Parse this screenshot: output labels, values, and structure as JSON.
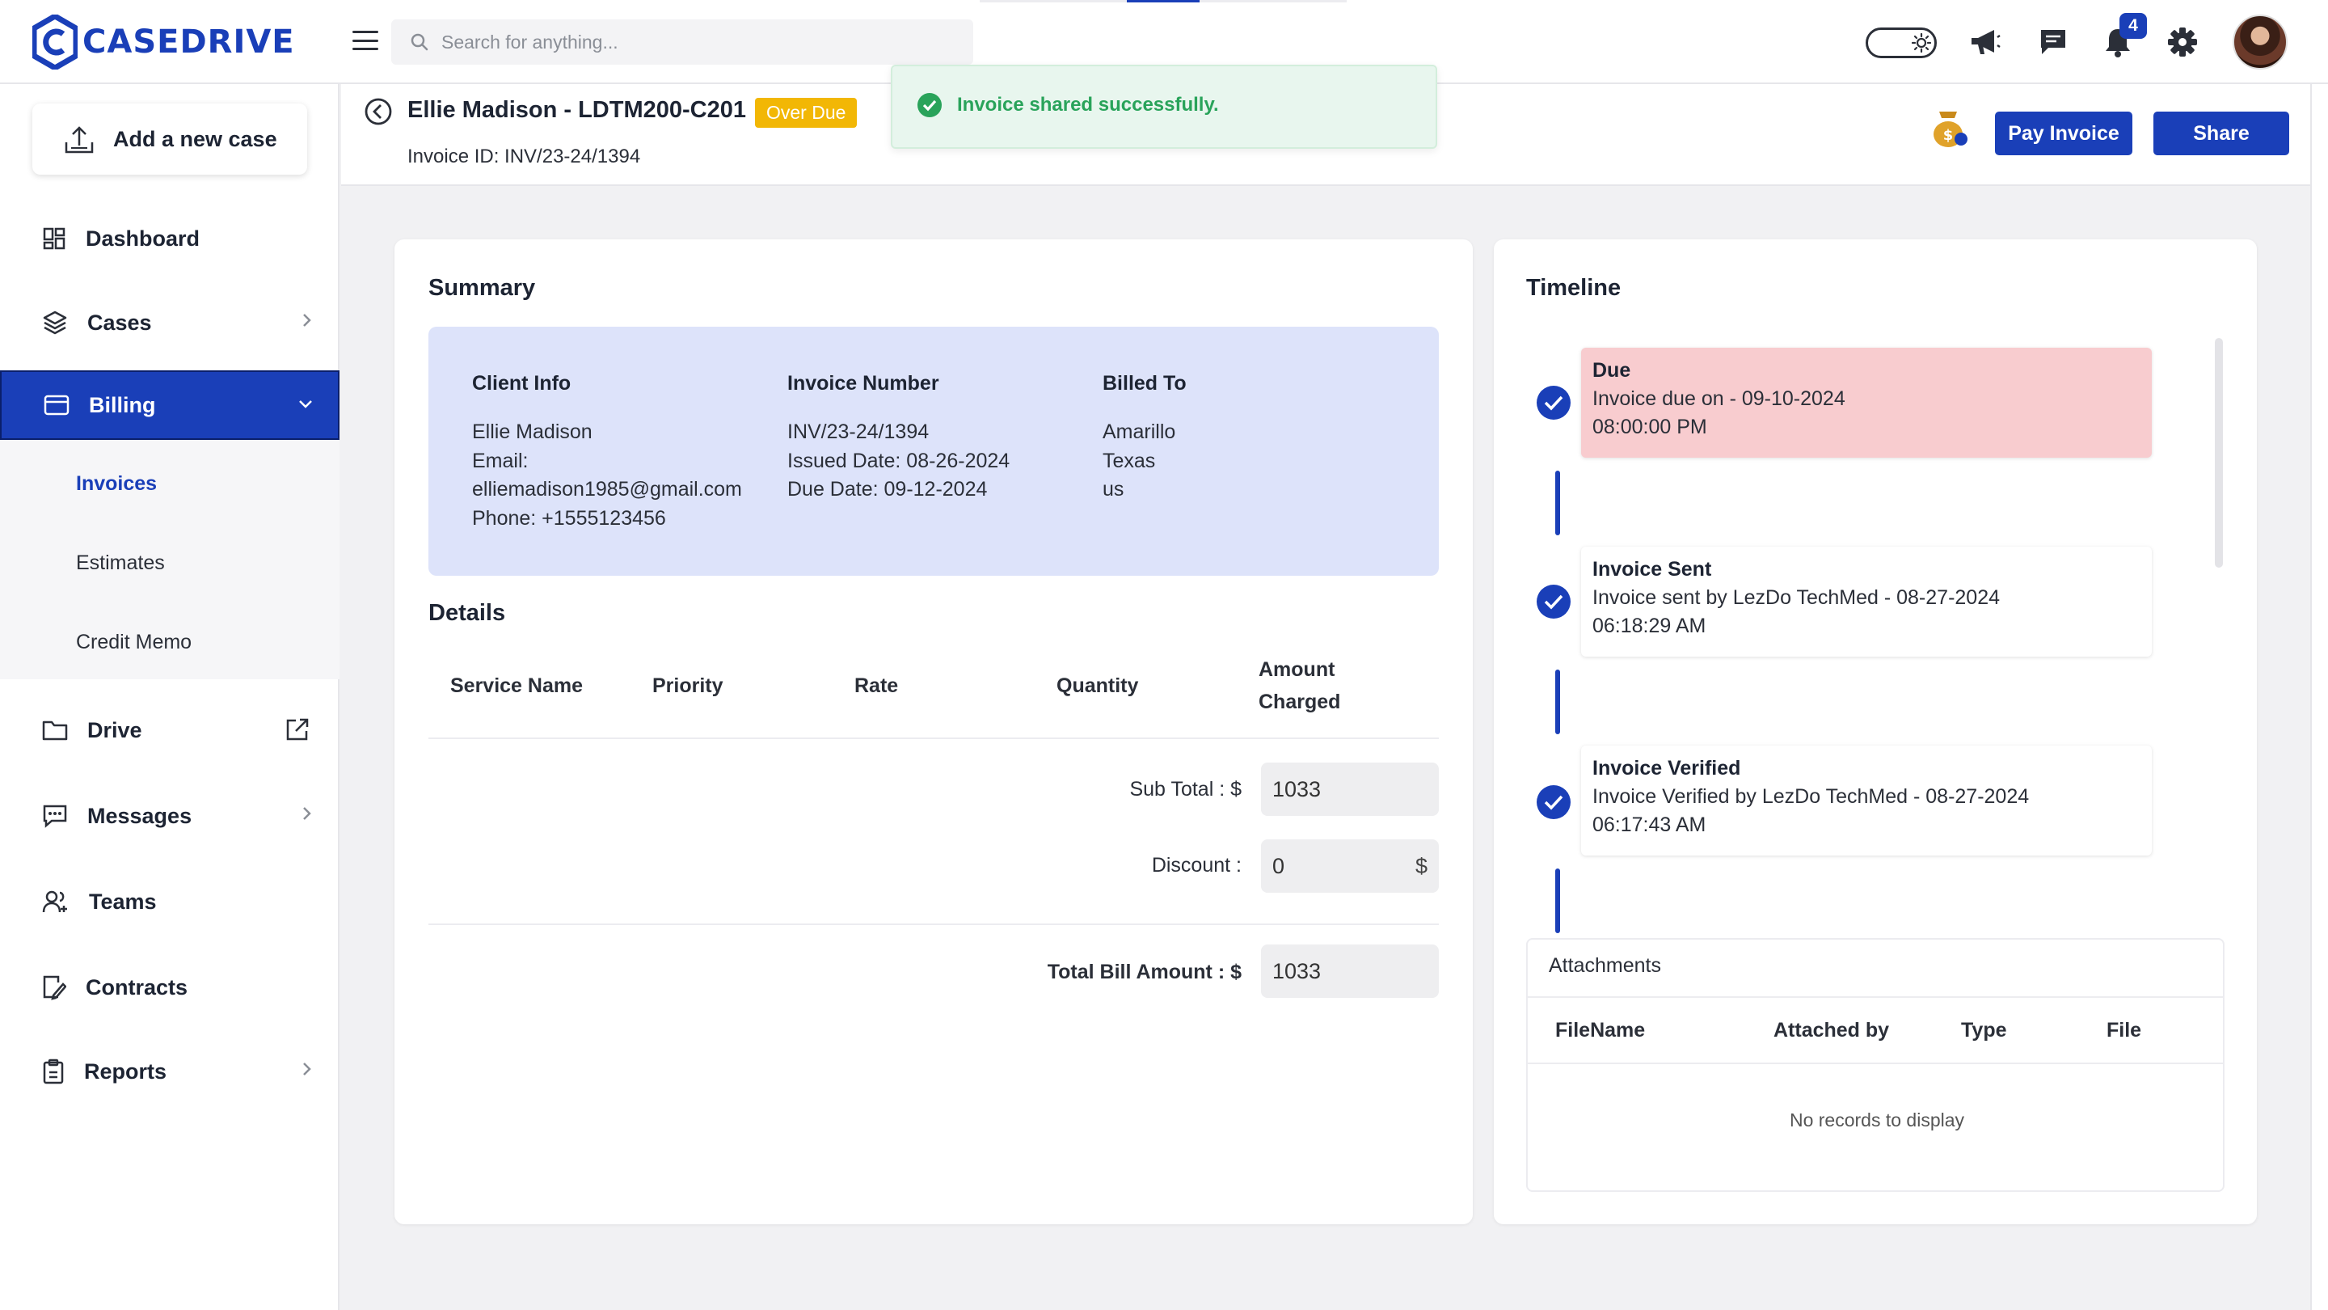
{
  "app": {
    "logo_text": "CASEDRIVE"
  },
  "header": {
    "search_placeholder": "Search for anything...",
    "notification_count": "4",
    "icons": [
      "theme-toggle-icon",
      "megaphone-icon",
      "chat-icon",
      "bell-icon",
      "gear-icon"
    ]
  },
  "sidebar": {
    "add_case_label": "Add a new case",
    "items": [
      {
        "label": "Dashboard",
        "icon": "grid-icon"
      },
      {
        "label": "Cases",
        "icon": "layers-icon"
      },
      {
        "label": "Billing",
        "icon": "card-icon",
        "active": true
      },
      {
        "label": "Drive",
        "icon": "folder-icon"
      },
      {
        "label": "Messages",
        "icon": "message-icon"
      },
      {
        "label": "Teams",
        "icon": "team-icon"
      },
      {
        "label": "Contracts",
        "icon": "contract-icon"
      },
      {
        "label": "Reports",
        "icon": "clipboard-icon"
      }
    ],
    "billing_sub": [
      {
        "label": "Invoices",
        "active": true
      },
      {
        "label": "Estimates"
      },
      {
        "label": "Credit Memo"
      }
    ]
  },
  "page": {
    "case_title": "Ellie Madison - LDTM200-C201",
    "status_badge": "Over Due",
    "invoice_id": "Invoice ID: INV/23-24/1394",
    "pay_button": "Pay Invoice",
    "share_button": "Share"
  },
  "toast": {
    "message": "Invoice shared successfully."
  },
  "summary": {
    "title": "Summary",
    "client_info": {
      "heading": "Client Info",
      "lines": [
        "Ellie Madison",
        "Email:",
        "elliemadison1985@gmail.com",
        "Phone: +1555123456"
      ]
    },
    "invoice_number": {
      "heading": "Invoice Number",
      "lines": [
        "INV/23-24/1394",
        "Issued Date: 08-26-2024",
        "Due Date: 09-12-2024"
      ]
    },
    "billed_to": {
      "heading": "Billed To",
      "lines": [
        "Amarillo",
        "Texas",
        "us"
      ]
    }
  },
  "details": {
    "title": "Details",
    "columns": [
      "Service Name",
      "Priority",
      "Rate",
      "Quantity",
      "Amount Charged"
    ],
    "subtotal_label": "Sub Total : $",
    "subtotal_value": "1033",
    "discount_label": "Discount :",
    "discount_value": "0",
    "discount_currency": "$",
    "total_label": "Total Bill Amount : $",
    "total_value": "1033"
  },
  "timeline": {
    "title": "Timeline",
    "events": [
      {
        "title": "Due",
        "line1": "Invoice due on - 09-10-2024",
        "line2": "08:00:00 PM"
      },
      {
        "title": "Invoice Sent",
        "line1": "Invoice sent by LezDo TechMed - 08-27-2024",
        "line2": "06:18:29 AM"
      },
      {
        "title": "Invoice Verified",
        "line1": "Invoice Verified by LezDo TechMed - 08-27-2024",
        "line2": "06:17:43 AM"
      }
    ]
  },
  "attachments": {
    "title": "Attachments",
    "columns": [
      "FileName",
      "Attached by",
      "Type",
      "File"
    ],
    "empty_text": "No records to display"
  },
  "colors": {
    "primary": "#1a3fb8",
    "overdue": "#f2b705",
    "due_card": "#f8cccf",
    "summary_bg": "#dde3fa",
    "toast_text": "#29a35a"
  }
}
